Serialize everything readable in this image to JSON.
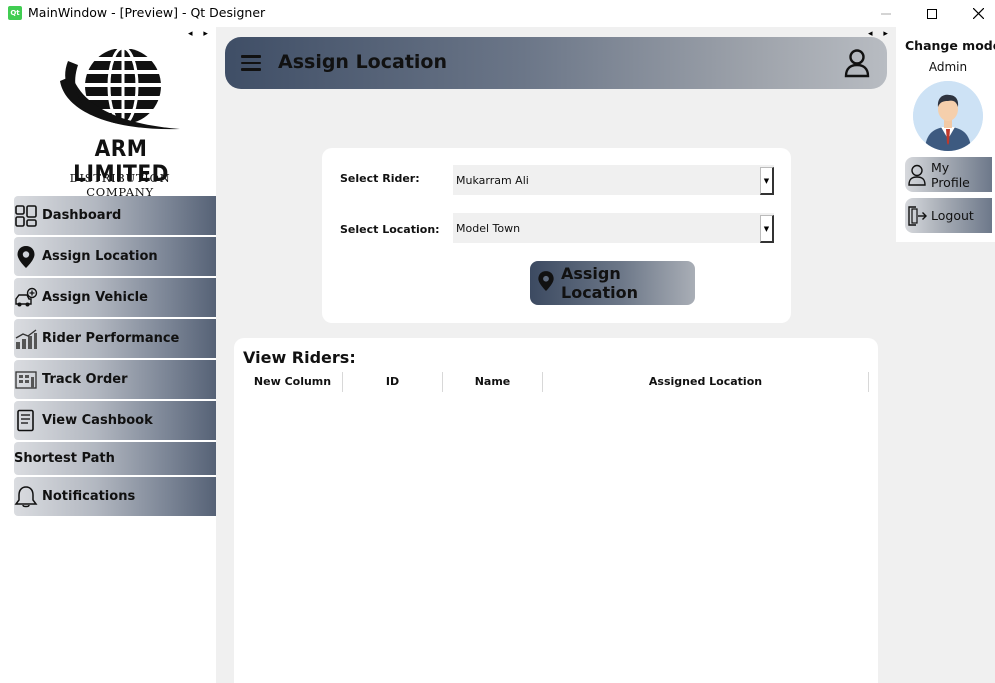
{
  "window": {
    "app_icon": "qt",
    "title": "MainWindow - [Preview] - Qt Designer"
  },
  "brand": {
    "company": "ARM LIMITED",
    "tagline": "DISTRIBUTION COMPANY"
  },
  "sidebar": {
    "items": [
      {
        "label": "Dashboard",
        "icon": "dashboard-grid-icon"
      },
      {
        "label": "Assign Location",
        "icon": "map-pin-icon"
      },
      {
        "label": "Assign Vehicle",
        "icon": "vehicle-icon"
      },
      {
        "label": "Rider Performance",
        "icon": "bar-chart-icon"
      },
      {
        "label": "Track Order",
        "icon": "track-order-icon"
      },
      {
        "label": "View Cashbook",
        "icon": "book-icon"
      },
      {
        "label": "Shortest Path",
        "icon": ""
      },
      {
        "label": "Notifications",
        "icon": "bell-icon"
      }
    ]
  },
  "header": {
    "title": "Assign Location"
  },
  "form": {
    "rider_label": "Select Rider:",
    "rider_value": "Mukarram Ali",
    "location_label": "Select Location:",
    "location_value": "Model Town",
    "assign_button": "Assign Location"
  },
  "table": {
    "title": "View Riders:",
    "columns": [
      "New Column",
      "ID",
      "Name",
      "Assigned Location"
    ],
    "rows": []
  },
  "profile": {
    "mode_label": "Change mode",
    "role": "Admin",
    "my_profile": "My Profile",
    "logout": "Logout"
  },
  "colors": {
    "accent_dark": "#3f4e66",
    "panel_bg": "#f0f0f0"
  }
}
